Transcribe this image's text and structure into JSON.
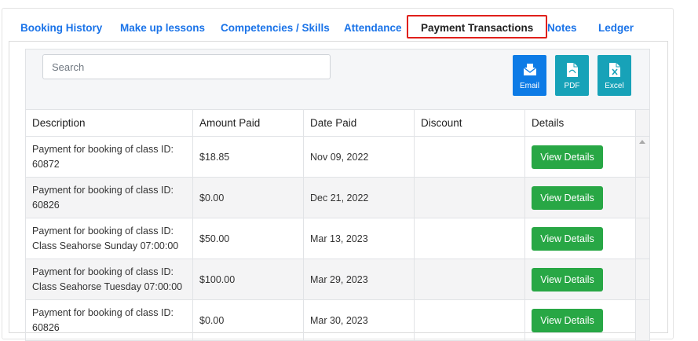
{
  "tabs": [
    {
      "label": "Booking History"
    },
    {
      "label": "Make up lessons"
    },
    {
      "label": "Competencies / Skills"
    },
    {
      "label": "Attendance"
    },
    {
      "label": "Payment Transactions"
    },
    {
      "label": "Notes"
    },
    {
      "label": "Ledger"
    }
  ],
  "active_tab": "Payment Transactions",
  "search": {
    "placeholder": "Search",
    "value": ""
  },
  "export_buttons": [
    {
      "label": "Email",
      "icon": "email-icon",
      "color": "#0d7be6"
    },
    {
      "label": "PDF",
      "icon": "pdf-icon",
      "color": "#17a2b8"
    },
    {
      "label": "Excel",
      "icon": "excel-icon",
      "color": "#17a2b8"
    }
  ],
  "table": {
    "columns": [
      "Description",
      "Amount Paid",
      "Date Paid",
      "Discount",
      "Details"
    ],
    "rows": [
      {
        "desc1": "Payment for booking of class ID:",
        "desc2": "60872",
        "amount": "$18.85",
        "date": "Nov 09, 2022",
        "discount": "",
        "details": "View Details"
      },
      {
        "desc1": "Payment for booking of class ID:",
        "desc2": "60826",
        "amount": "$0.00",
        "date": "Dec 21, 2022",
        "discount": "",
        "details": "View Details"
      },
      {
        "desc1": "Payment for booking of class ID:",
        "desc2": "Class Seahorse Sunday 07:00:00",
        "amount": "$50.00",
        "date": "Mar 13, 2023",
        "discount": "",
        "details": "View Details"
      },
      {
        "desc1": "Payment for booking of class ID:",
        "desc2": "Class Seahorse Tuesday 07:00:00",
        "amount": "$100.00",
        "date": "Mar 29, 2023",
        "discount": "",
        "details": "View Details"
      },
      {
        "desc1": "Payment for booking of class ID:",
        "desc2": "60826",
        "amount": "$0.00",
        "date": "Mar 30, 2023",
        "discount": "",
        "details": "View Details"
      }
    ]
  },
  "colors": {
    "tab_link": "#1a73e8",
    "active_tab_border": "#e0201b",
    "view_button": "#28a745",
    "email_button": "#0d7be6",
    "export_button": "#17a2b8"
  }
}
